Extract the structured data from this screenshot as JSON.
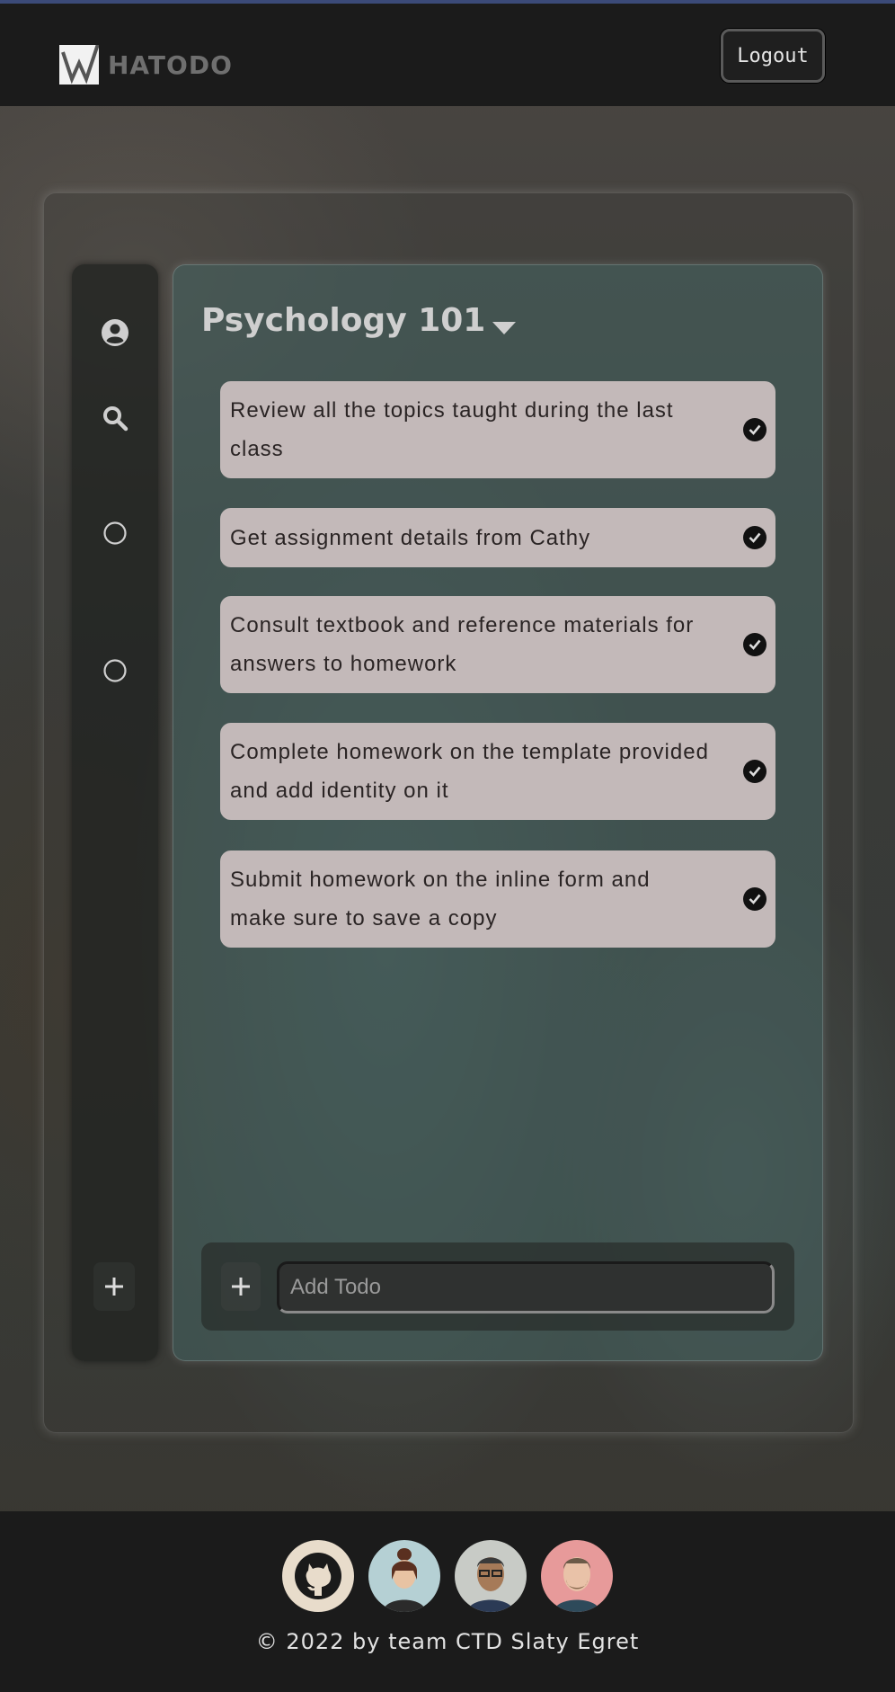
{
  "app": {
    "logo_text": "HATODO"
  },
  "header": {
    "logout_label": "Logout"
  },
  "sidebar": {
    "items": [
      {
        "icon": "user-circle-icon"
      },
      {
        "icon": "search-icon"
      },
      {
        "icon": "list-circle-icon"
      },
      {
        "icon": "list-circle-icon"
      }
    ],
    "add_icon": "plus-icon"
  },
  "main": {
    "list_title": "Psychology 101",
    "todos": [
      {
        "text": "Review all the topics taught during the last class",
        "done": true
      },
      {
        "text": "Get assignment details from Cathy",
        "done": true
      },
      {
        "text": "Consult textbook and reference materials for answers to homework",
        "done": true
      },
      {
        "text": "Complete homework on the template provided and add identity on it",
        "done": true
      },
      {
        "text": "Submit homework on the inline form and make sure to save a copy",
        "done": true
      }
    ],
    "add_todo": {
      "placeholder": "Add Todo",
      "value": ""
    }
  },
  "footer": {
    "avatars": [
      {
        "name": "github-icon"
      },
      {
        "name": "team-member-avatar"
      },
      {
        "name": "team-member-avatar"
      },
      {
        "name": "team-member-avatar"
      }
    ],
    "copyright": "© 2022 by team CTD Slaty Egret"
  },
  "colors": {
    "header_bg": "#1b1b1b",
    "todo_bg": "#c3b9b9",
    "panel_bg": "#466462",
    "title_text": "#cfcfcf"
  }
}
